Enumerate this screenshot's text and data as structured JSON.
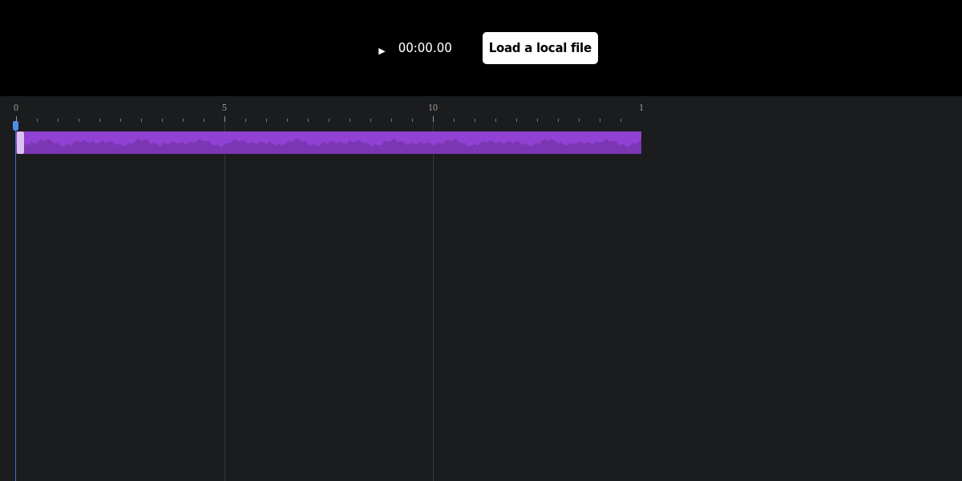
{
  "player": {
    "play_glyph": "▶",
    "time": "00:00.00",
    "load_button": "Load a local file"
  },
  "timeline": {
    "ruler_labels": [
      "0",
      "5",
      "10",
      "1"
    ],
    "playhead": {
      "level": 0
    },
    "track": {
      "kind": "waveform"
    }
  }
}
